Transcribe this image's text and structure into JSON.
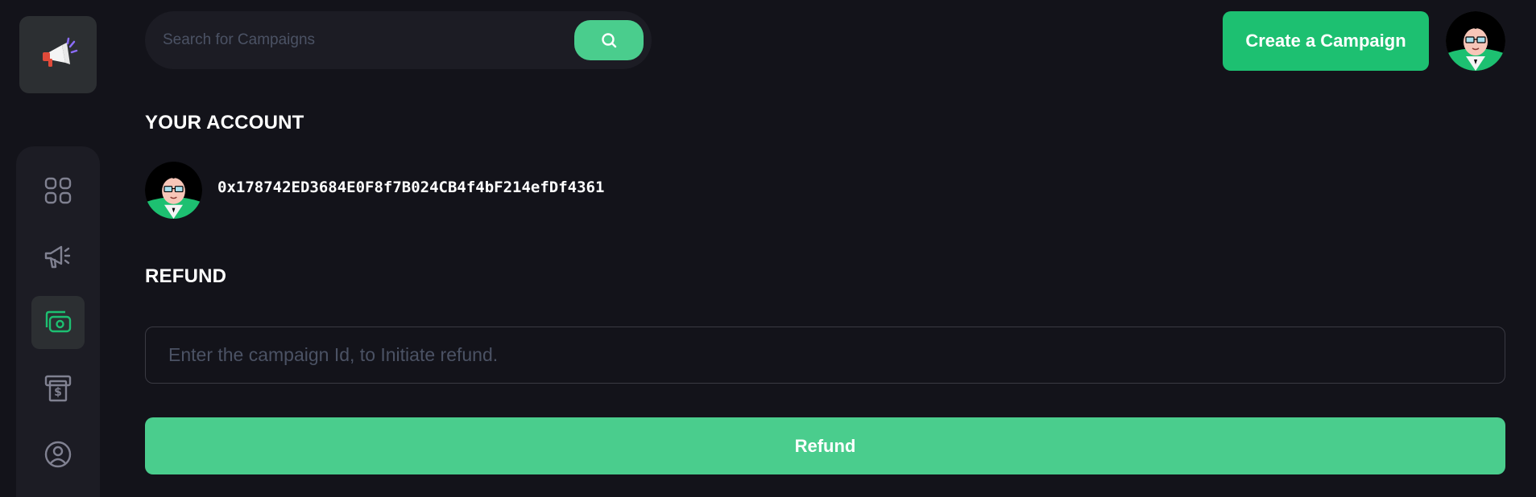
{
  "search": {
    "placeholder": "Search for Campaigns",
    "icon": "search-icon"
  },
  "header": {
    "create_button_label": "Create a Campaign",
    "avatar_icon": "user-avatar"
  },
  "sidebar": {
    "logo_icon": "megaphone-logo-icon",
    "items": [
      {
        "name": "dashboard",
        "icon": "grid-icon",
        "active": false
      },
      {
        "name": "campaign",
        "icon": "megaphone-icon",
        "active": false
      },
      {
        "name": "payment",
        "icon": "money-icon",
        "active": true
      },
      {
        "name": "withdraw",
        "icon": "withdraw-icon",
        "active": false
      },
      {
        "name": "profile",
        "icon": "profile-icon",
        "active": false
      }
    ]
  },
  "account": {
    "heading": "YOUR ACCOUNT",
    "address": "0x178742ED3684E0F8f7B024CB4f4bF214efDf4361"
  },
  "refund": {
    "heading": "REFUND",
    "input_placeholder": "Enter the campaign Id, to Initiate refund.",
    "input_value": "",
    "button_label": "Refund"
  },
  "colors": {
    "background": "#13131a",
    "panel": "#1c1c24",
    "accent": "#4acd8d",
    "accent_dark": "#1dc071",
    "muted_text": "#4b5264",
    "active_nav": "#2c2f32"
  }
}
